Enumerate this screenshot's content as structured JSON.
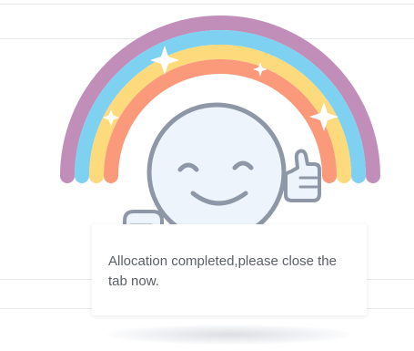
{
  "message": {
    "text": "Allocation completed,please close the tab now."
  },
  "illustration": {
    "rainbow_colors": [
      "#c18db9",
      "#7fd1f2",
      "#fddb7c",
      "#fb9a7b"
    ],
    "face_fill": "#eef4fb",
    "outline_color": "#8d97a5",
    "sparkle_color": "#ffffff",
    "icons": [
      "rainbow-icon",
      "smiley-face-icon",
      "thumbs-up-icon",
      "sparkle-icon"
    ]
  }
}
